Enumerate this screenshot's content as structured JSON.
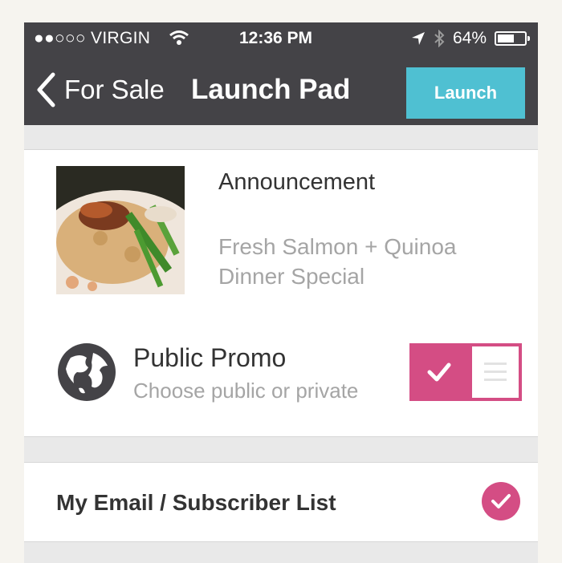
{
  "status_bar": {
    "carrier": "●●○○○ VIRGIN",
    "time": "12:36 PM",
    "battery": "64%",
    "battery_level": 0.64
  },
  "nav": {
    "back_label": "For Sale",
    "title": "Launch Pad",
    "launch_label": "Launch"
  },
  "announcement": {
    "label": "Announcement",
    "text_line1": "Fresh Salmon + Quinoa",
    "text_line2": "Dinner Special"
  },
  "promo": {
    "title": "Public Promo",
    "subtitle": "Choose public or private",
    "enabled": true
  },
  "email": {
    "label": "My Email / Subscriber List",
    "checked": true
  },
  "colors": {
    "header": "#444347",
    "accent_blue": "#4fc0d2",
    "accent_pink": "#d44d84"
  },
  "icons": [
    "wifi-icon",
    "location-arrow-icon",
    "bluetooth-icon",
    "battery-icon",
    "back-chevron-icon",
    "globe-icon",
    "check-icon",
    "menu-lines-icon"
  ]
}
